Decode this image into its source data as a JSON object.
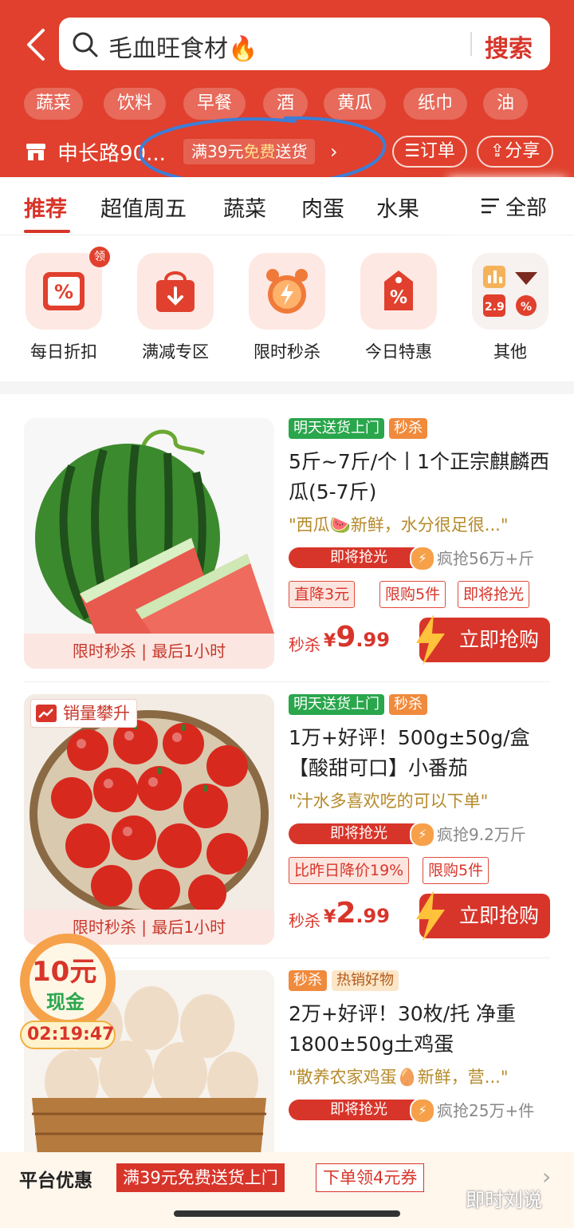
{
  "header": {
    "search_query": "毛血旺食材🔥",
    "search_button": "搜索",
    "quick_chips": [
      "蔬菜",
      "饮料",
      "早餐",
      "酒",
      "黄瓜",
      "纸巾",
      "油"
    ],
    "address": "申长路90...",
    "promo_prefix": "满39元",
    "promo_free": "免费",
    "promo_suffix": "送货",
    "orders_label": "订单",
    "share_label": "分享"
  },
  "tabs": {
    "items": [
      "推荐",
      "超值周五",
      "蔬菜",
      "肉蛋",
      "水果"
    ],
    "active_index": 0,
    "all_label": "全部"
  },
  "categories": [
    {
      "label": "每日折扣",
      "icon": "percent-tag-icon",
      "badge": "领"
    },
    {
      "label": "满减专区",
      "icon": "shopping-bag-icon"
    },
    {
      "label": "限时秒杀",
      "icon": "alarm-clock-icon"
    },
    {
      "label": "今日特惠",
      "icon": "price-tag-icon"
    },
    {
      "label": "其他",
      "icon": "grid-icon",
      "mini_label": "2.9"
    }
  ],
  "products": [
    {
      "tags": [
        "明天送货上门",
        "秒杀"
      ],
      "title": "5斤~7斤/个丨1个正宗麒麟西瓜(5-7斤)",
      "quote": "\"西瓜🍉新鲜，水分很足很...\"",
      "rush_label": "即将抢光",
      "sold": "疯抢56万+斤",
      "price_tags": [
        "直降3元",
        "限购5件",
        "即将抢光"
      ],
      "price_prefix": "秒杀",
      "currency": "¥",
      "price_int": "9",
      "price_dec": ".99",
      "buy_label": "立即抢购",
      "image_caption": "限时秒杀 | 最后1小时",
      "image": "watermelon"
    },
    {
      "tags": [
        "明天送货上门",
        "秒杀"
      ],
      "title": "1万+好评！500g±50g/盒【酸甜可口】小番茄",
      "quote": "\"汁水多喜欢吃的可以下单\"",
      "rush_label": "即将抢光",
      "sold": "疯抢9.2万斤",
      "price_tags": [
        "比昨日降价19%",
        "限购5件"
      ],
      "price_prefix": "秒杀",
      "currency": "¥",
      "price_int": "2",
      "price_dec": ".99",
      "buy_label": "立即抢购",
      "image_caption": "限时秒杀 | 最后1小时",
      "image_badge": "销量攀升",
      "image": "tomatoes"
    },
    {
      "tags": [
        "秒杀",
        "热销好物"
      ],
      "title": "2万+好评！30枚/托 净重1800±50g土鸡蛋",
      "quote": "\"散养农家鸡蛋🥚新鲜，营...\"",
      "rush_label": "即将抢光",
      "sold": "疯抢25万+件",
      "image": "eggs"
    }
  ],
  "coupon_float": {
    "amount": "10元",
    "label": "现金",
    "timer": "02:19:47"
  },
  "bottom_bar": {
    "label": "平台优惠",
    "offer1": "满39元免费送货上门",
    "offer2": "下单领4元券"
  },
  "watermark": "即时刘说",
  "colors": {
    "brand_red": "#e0402d",
    "price_red": "#d8352a",
    "green_tag": "#2aa64c",
    "annotation_blue": "#3b7fd9"
  }
}
